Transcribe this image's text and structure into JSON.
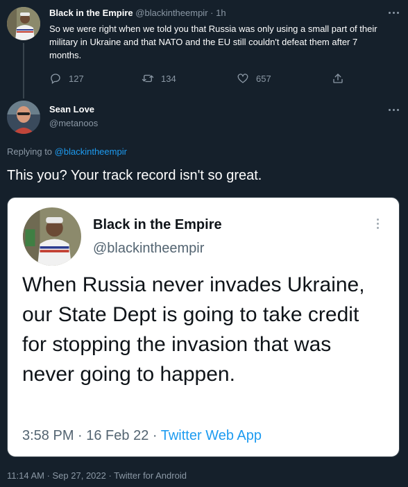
{
  "parent_tweet": {
    "display_name": "Black in the Empire",
    "handle": "@blackintheempir",
    "separator": "·",
    "time": "1h",
    "text": "So we were right when we told you that Russia was only using a small part of their military in Ukraine and that NATO and the EU still couldn't defeat them after 7 months.",
    "replies": "127",
    "retweets": "134",
    "likes": "657"
  },
  "reply_tweet": {
    "display_name": "Sean Love",
    "handle": "@metanoos",
    "replying_prefix": "Replying to",
    "replying_to": "@blackintheempir",
    "text": "This you? Your track record isn't so great.",
    "timestamp": "11:14 AM · Sep 27, 2022 · Twitter for Android"
  },
  "embedded_screenshot": {
    "display_name": "Black in the Empire",
    "handle": "@blackintheempir",
    "text": "When Russia never invades Ukraine, our State Dept is going to take credit for stopping the invasion that was never going to happen.",
    "time": "3:58 PM · 16 Feb 22 ·",
    "source": "Twitter Web App"
  },
  "colors": {
    "background": "#15202b",
    "text": "#ffffff",
    "muted": "#8b98a5",
    "accent": "#1d9bf0",
    "card_background": "#ffffff",
    "card_text": "#0f1419"
  },
  "icons": [
    "reply-icon",
    "retweet-icon",
    "like-icon",
    "share-icon",
    "more-icon",
    "thread-line"
  ]
}
